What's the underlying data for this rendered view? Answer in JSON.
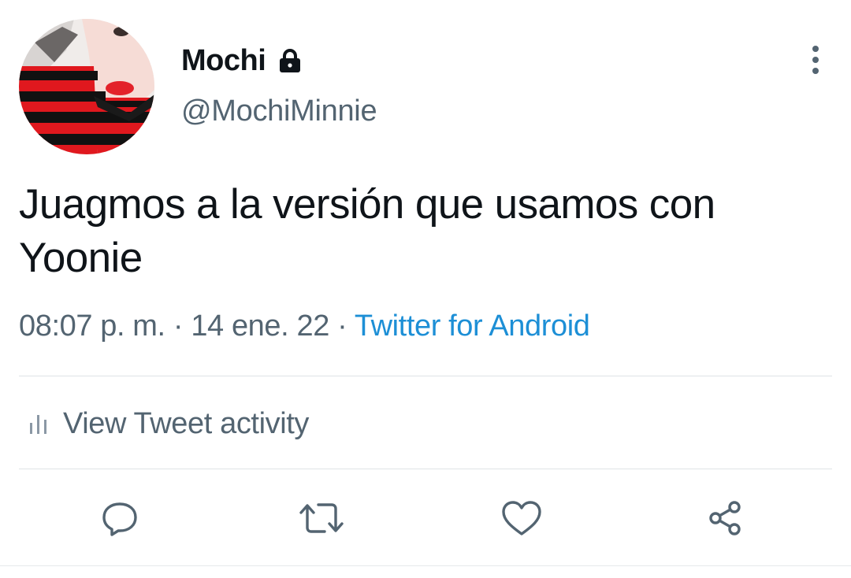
{
  "user": {
    "display_name": "Mochi",
    "handle": "@MochiMinnie",
    "protected_icon": "lock-icon",
    "avatar_description_colors": [
      "#e0181e",
      "#111111"
    ]
  },
  "tweet": {
    "text": "Juagmos a la versión que usamos con Yoonie",
    "time": "08:07 p. m.",
    "separator": "·",
    "date": "14 ene. 22",
    "source": "Twitter for Android"
  },
  "activity": {
    "label": "View Tweet activity",
    "icon": "bar-chart-icon"
  },
  "actions": [
    {
      "name": "reply",
      "icon": "comment-icon"
    },
    {
      "name": "retweet",
      "icon": "retweet-icon"
    },
    {
      "name": "like",
      "icon": "heart-icon"
    },
    {
      "name": "share",
      "icon": "share-icon"
    }
  ],
  "colors": {
    "text_primary": "#0f1419",
    "text_secondary": "#536471",
    "link": "#1d8fd6",
    "divider": "#dfe3e6"
  }
}
